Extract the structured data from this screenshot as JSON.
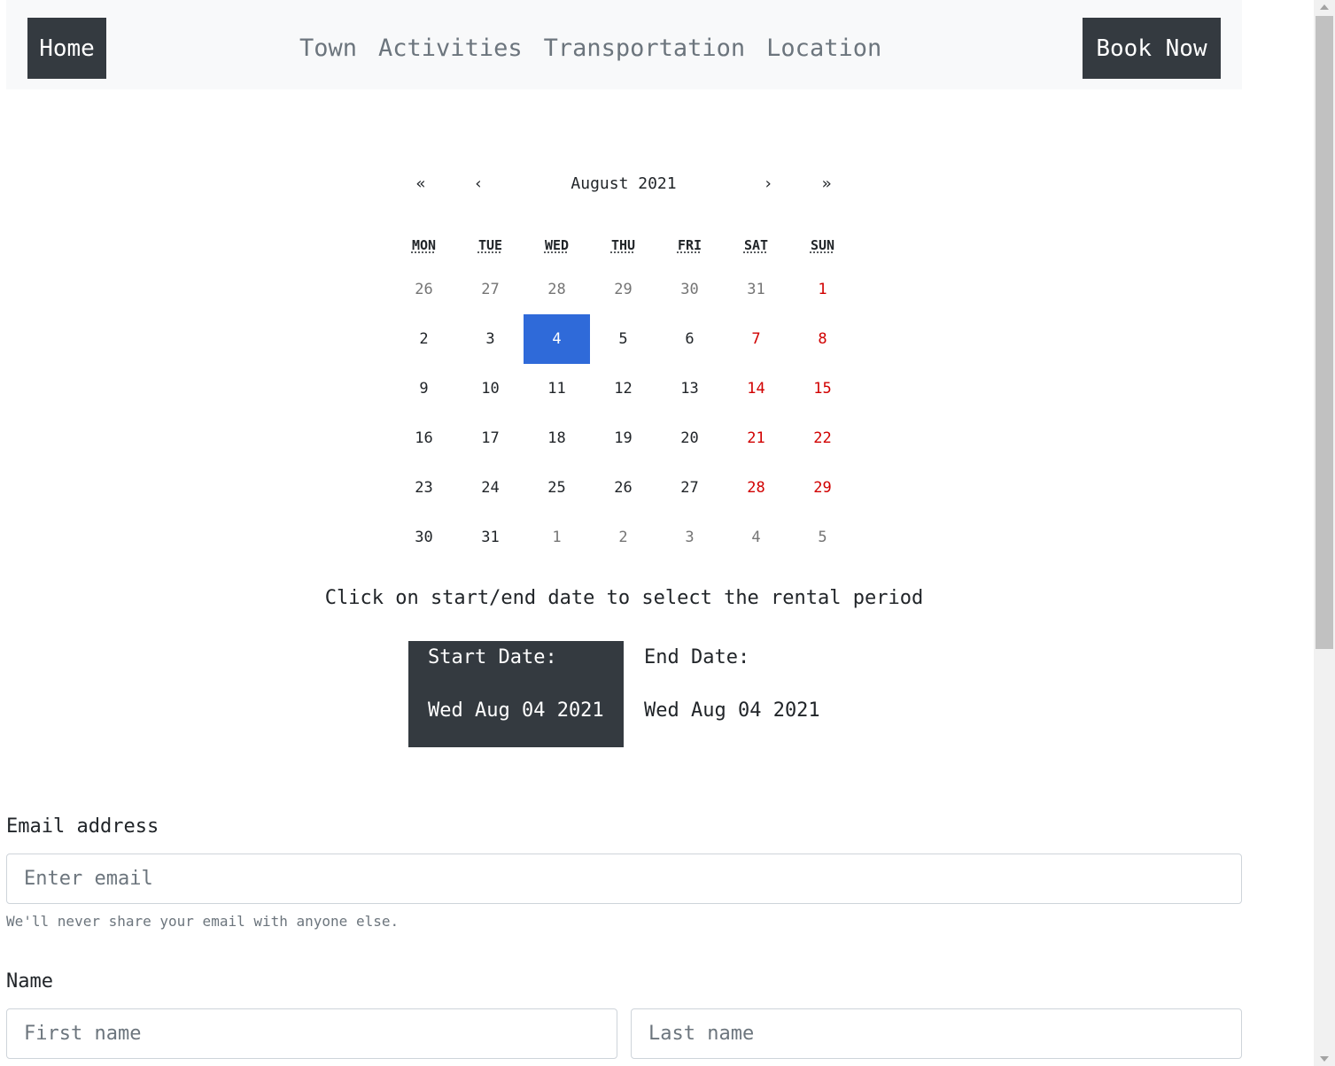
{
  "navbar": {
    "home_label": "Home",
    "links": [
      "Town",
      "Activities",
      "Transportation",
      "Location"
    ],
    "book_label": "Book Now"
  },
  "calendar": {
    "nav": {
      "prev2": "«",
      "prev": "‹",
      "label": "August 2021",
      "next": "›",
      "next2": "»"
    },
    "weekdays": [
      "MON",
      "TUE",
      "WED",
      "THU",
      "FRI",
      "SAT",
      "SUN"
    ],
    "days": [
      {
        "d": "26",
        "type": "neighbor"
      },
      {
        "d": "27",
        "type": "neighbor"
      },
      {
        "d": "28",
        "type": "neighbor"
      },
      {
        "d": "29",
        "type": "neighbor"
      },
      {
        "d": "30",
        "type": "neighbor"
      },
      {
        "d": "31",
        "type": "neighbor"
      },
      {
        "d": "1",
        "type": "weekend"
      },
      {
        "d": "2"
      },
      {
        "d": "3"
      },
      {
        "d": "4",
        "type": "selected"
      },
      {
        "d": "5"
      },
      {
        "d": "6"
      },
      {
        "d": "7",
        "type": "weekend"
      },
      {
        "d": "8",
        "type": "weekend"
      },
      {
        "d": "9"
      },
      {
        "d": "10"
      },
      {
        "d": "11"
      },
      {
        "d": "12"
      },
      {
        "d": "13"
      },
      {
        "d": "14",
        "type": "weekend"
      },
      {
        "d": "15",
        "type": "weekend"
      },
      {
        "d": "16"
      },
      {
        "d": "17"
      },
      {
        "d": "18"
      },
      {
        "d": "19"
      },
      {
        "d": "20"
      },
      {
        "d": "21",
        "type": "weekend"
      },
      {
        "d": "22",
        "type": "weekend"
      },
      {
        "d": "23"
      },
      {
        "d": "24"
      },
      {
        "d": "25"
      },
      {
        "d": "26"
      },
      {
        "d": "27"
      },
      {
        "d": "28",
        "type": "weekend"
      },
      {
        "d": "29",
        "type": "weekend"
      },
      {
        "d": "30"
      },
      {
        "d": "31"
      },
      {
        "d": "1",
        "type": "neighbor"
      },
      {
        "d": "2",
        "type": "neighbor"
      },
      {
        "d": "3",
        "type": "neighbor"
      },
      {
        "d": "4",
        "type": "neighbor"
      },
      {
        "d": "5",
        "type": "neighbor"
      }
    ],
    "colors": {
      "selected": "#2f6ad9",
      "weekend": "#d10000",
      "neighbor": "#757575"
    }
  },
  "rental": {
    "hint": "Click on start/end date to select the rental period",
    "start_label": "Start Date:",
    "start_value": "Wed Aug 04 2021",
    "end_label": "End Date:",
    "end_value": "Wed Aug 04 2021"
  },
  "form": {
    "email_label": "Email address",
    "email_value": "",
    "email_placeholder": "Enter email",
    "email_help": "We'll never share your email with anyone else.",
    "name_label": "Name",
    "first_value": "",
    "first_placeholder": "First name",
    "last_value": "",
    "last_placeholder": "Last name"
  }
}
